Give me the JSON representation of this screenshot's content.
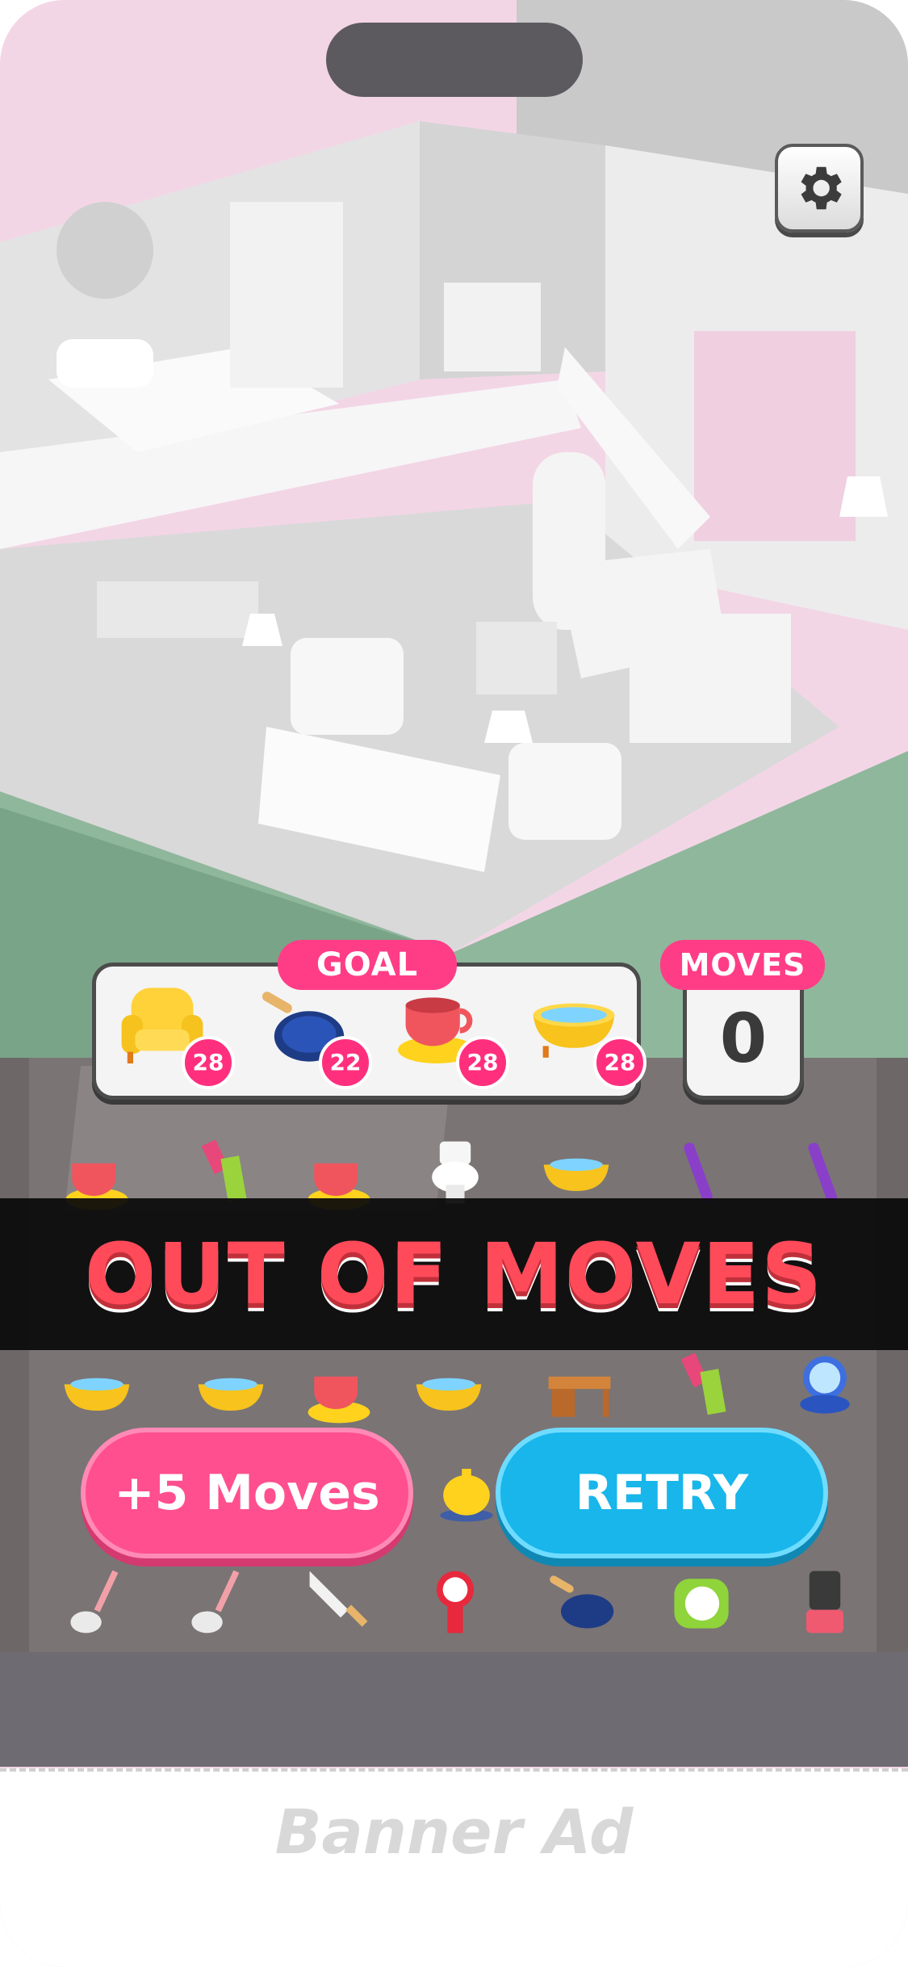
{
  "hud": {
    "goal_label": "GOAL",
    "moves_label": "MOVES",
    "moves_value": "0",
    "goals": [
      {
        "icon": "armchair-icon",
        "count": "28"
      },
      {
        "icon": "frying-pan-icon",
        "count": "22"
      },
      {
        "icon": "teacup-icon",
        "count": "28"
      },
      {
        "icon": "bathtub-icon",
        "count": "28"
      }
    ]
  },
  "popup": {
    "title": "OUT OF MOVES",
    "extra_moves_label": "+5 Moves",
    "retry_label": "RETRY"
  },
  "ad": {
    "label": "Banner Ad"
  },
  "colors": {
    "pink": "#ff3d86",
    "blue": "#18b6ea",
    "title_red": "#ff4a5a"
  }
}
